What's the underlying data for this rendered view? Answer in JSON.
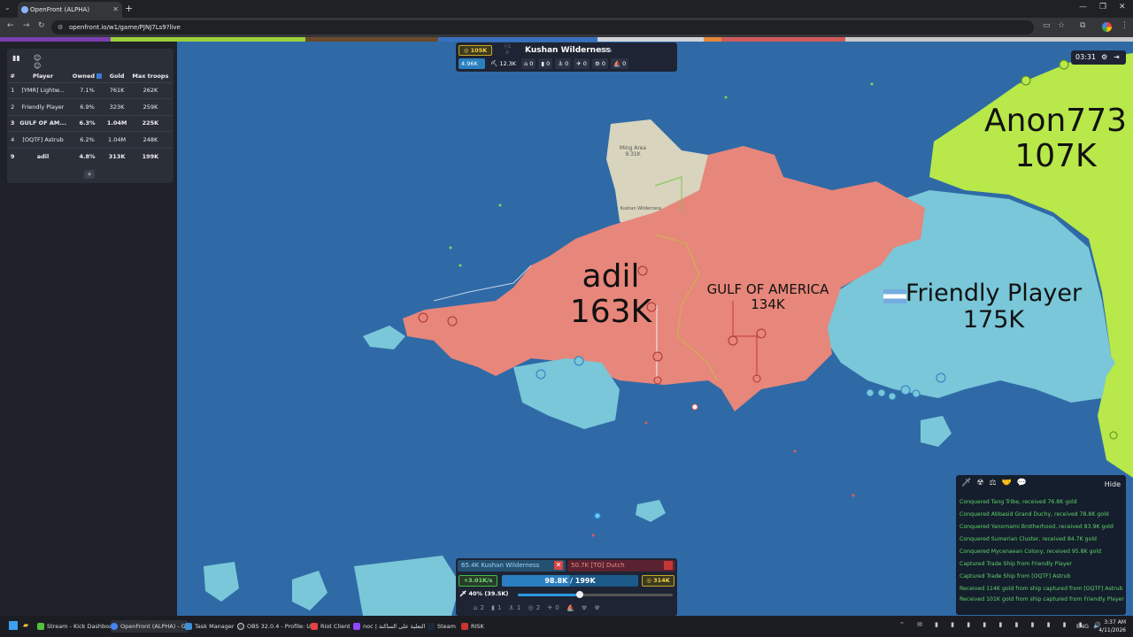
{
  "browser": {
    "tab_title": "OpenFront (ALPHA)",
    "url": "openfront.io/w1/game/PJNJ7Ls9?live",
    "new_tab": "+"
  },
  "leaderboard": {
    "headers": [
      "#",
      "Player",
      "Owned",
      "Gold",
      "Max troops"
    ],
    "rows": [
      {
        "rank": "1",
        "player": "[YMR] Lightw...",
        "owned": "7.1%",
        "gold": "761K",
        "troops": "262K"
      },
      {
        "rank": "2",
        "player": "Friendly Player",
        "owned": "6.9%",
        "gold": "323K",
        "troops": "259K"
      },
      {
        "rank": "3",
        "player": "GULF OF AM...",
        "owned": "6.3%",
        "gold": "1.04M",
        "troops": "225K"
      },
      {
        "rank": "4",
        "player": "[OQTF] Astrub",
        "owned": "6.2%",
        "gold": "1.04M",
        "troops": "248K"
      },
      {
        "rank": "9",
        "player": "adil",
        "owned": "4.8%",
        "gold": "313K",
        "troops": "199K"
      }
    ],
    "expand": "+"
  },
  "map": {
    "labels": {
      "adil_name": "adil",
      "adil_troops": "163K",
      "gulf_name": "GULF OF AMERICA",
      "gulf_troops": "134K",
      "friendly_name": "Friendly Player",
      "friendly_troops": "175K",
      "anon_name": "Anon773",
      "anon_troops": "107K",
      "ming_name": "Ming Area",
      "ming_troops": "9.31K",
      "kushan_name": "Kushan Wilderness"
    },
    "colors": {
      "ocean": "#2f6aa7",
      "adil": "#e7867a",
      "friendly": "#79c7d8",
      "anon": "#b8e84a",
      "neutral": "#d9d4bd"
    }
  },
  "info_bar": {
    "gold": "105K",
    "name": "Kushan Wilderness",
    "type": "Tribe",
    "small_a": "ⓧ1",
    "small_b": "0",
    "troops": "4.96K",
    "workers": "12.3K",
    "counts": [
      "0",
      "0",
      "0",
      "0",
      "0",
      "0"
    ]
  },
  "timer": "03:31",
  "events": {
    "hide_label": "Hide",
    "items": [
      "Conquered Tang Tribe, received 76.8K gold",
      "Conquered Abbasid Grand Duchy, received 78.8K gold",
      "Conquered Yanomami Brotherhood, received 83.9K gold",
      "Conquered Sumerian Cluster, received 84.7K gold",
      "Conquered Mycenaean Colony, received 95.8K gold",
      "Captured Trade Ship from Friendly Player",
      "Captured Trade Ship from [OQTF] Astrub",
      "Received 114K gold from ship captured from [OQTF] Astrub",
      "Received 101K gold from ship captured from Friendly Player"
    ]
  },
  "control": {
    "attack": "65.4K  Kushan Wilderness",
    "defend": "50.7K  [TO] Dutch",
    "rate": "+3.01K/s",
    "troops": "98.8K / 199K",
    "troops_fraction": 0.4965,
    "gold": "314K",
    "ratio": "40% (39.5K)",
    "ratio_fraction": 0.4,
    "icons": "⌂2 ▮1 ⚓1 ◎2 ✈0 ⛵ ☢ ☢"
  },
  "taskbar": {
    "items": [
      "Stream - Kick Dashboar",
      "OpenFront (ALPHA) - Gc",
      "Task Manager",
      "OBS 32.0.4 - Profile: Unt",
      "Riot Client",
      "noc | التعلية على الساكنة",
      "Steam",
      "RISK"
    ],
    "lang": "ENG",
    "time": "3:37 AM",
    "date": "4/11/2026"
  }
}
